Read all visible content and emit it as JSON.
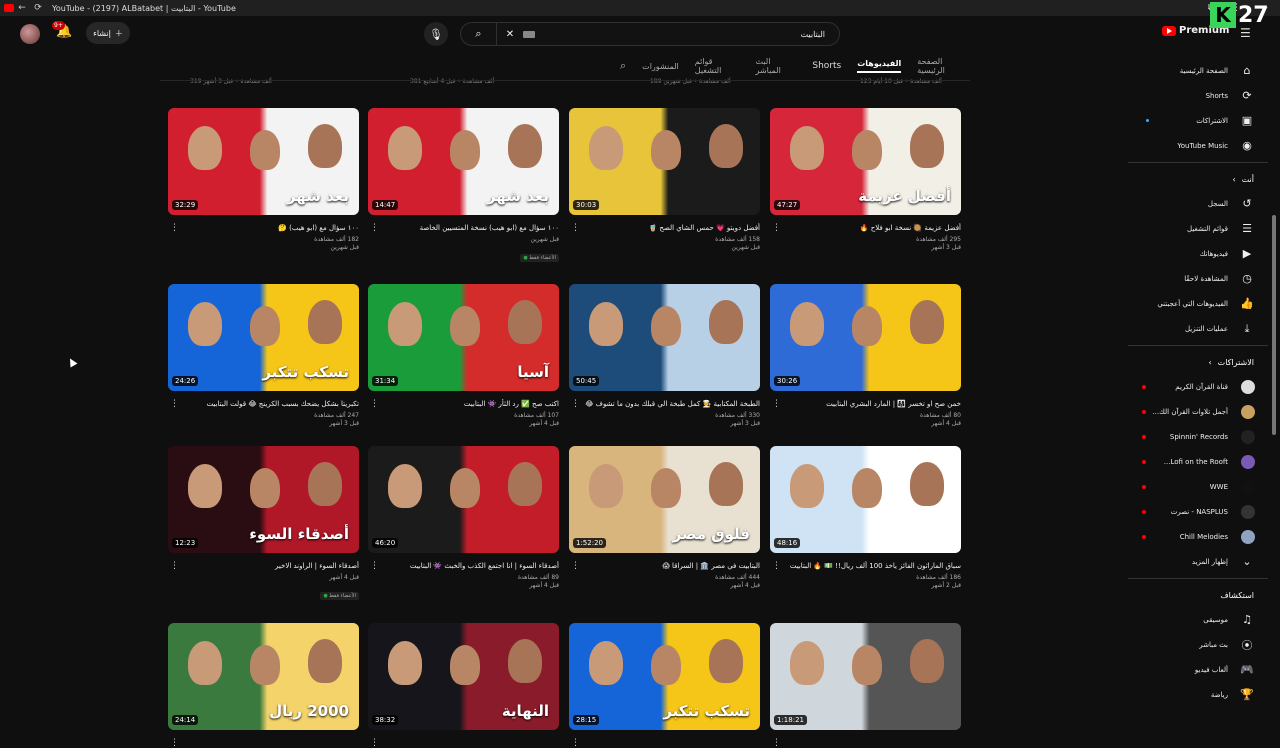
{
  "window": {
    "title": "YouTube - (2197) ALBatabet | البتابيت - YouTube"
  },
  "header": {
    "create_label": "إنشاء",
    "notif_count": "9+",
    "search_value": "البتابيت",
    "logo_text": "Premium",
    "overlay_number": "27"
  },
  "tabs": [
    "الصفحة الرئيسية",
    "الفيديوهات",
    "Shorts",
    "البث المباشر",
    "قوائم التشغيل",
    "المنشورات"
  ],
  "prev_row_meta": [
    "319 ألف مشاهدة • قبل 3 أشهر",
    "381 ألف مشاهدة • قبل 4 أسابيع",
    "189 ألف مشاهدة • قبل شهرين",
    "123 ألف مشاهدة • قبل 10 أيام"
  ],
  "videos": [
    {
      "title": "أفضل عزيمة 🥘 نسخة ابو فلاح 🔥",
      "views": "295 ألف مشاهدة",
      "age": "قبل 3 أشهر",
      "duration": "47:27",
      "overlay": "أفضل عزيمة",
      "members_only": ""
    },
    {
      "title": "أفضل دويتو 💗 حمس الشاي الصح 🧋",
      "views": "158 ألف مشاهدة",
      "age": "قبل شهرين",
      "duration": "30:03",
      "overlay": "",
      "members_only": ""
    },
    {
      "title": "١٠٠ سؤال مع (ابو هيب) نسخة المتسيين الخاصة",
      "views": "قبل شهرين",
      "age": "",
      "duration": "14:47",
      "overlay": "بعد شهر",
      "members_only": "الأعضاء فقط"
    },
    {
      "title": "١٠٠ سؤال مع (ابو هيب) 🤔",
      "views": "182 ألف مشاهدة",
      "age": "قبل شهرين",
      "duration": "32:29",
      "overlay": "بعد شهر",
      "members_only": ""
    },
    {
      "title": "خمن صح او تخسر 👨‍👩‍👧 | المارد البشري البتابيت",
      "views": "80 ألف مشاهدة",
      "age": "قبل 4 أشهر",
      "duration": "30:26",
      "overlay": "",
      "members_only": ""
    },
    {
      "title": "الطبخة المكتابية 🧑‍🍳 كمل طبخة الي قبلك بدون ما تشوف 😂",
      "views": "330 ألف مشاهدة",
      "age": "قبل 3 أشهر",
      "duration": "50:45",
      "overlay": "",
      "members_only": ""
    },
    {
      "title": "اكتب صح ✅ رد الثأر 👾 البتابيت",
      "views": "107 ألف مشاهدة",
      "age": "قبل 4 أشهر",
      "duration": "31:34",
      "overlay": "آسيا",
      "members_only": ""
    },
    {
      "title": "تكبريتا بشكل يضحك بسبب الكرينج 😂 قولت البتابيت",
      "views": "247 ألف مشاهدة",
      "age": "قبل 3 أشهر",
      "duration": "24:26",
      "overlay": "تسكب تتكبر",
      "members_only": ""
    },
    {
      "title": "سباق الماراثون الفائز ياخذ 100 ألف ريال!! 💵 🔥 البتابيت",
      "views": "186 ألف مشاهدة",
      "age": "قبل 2 أشهر",
      "duration": "48:16",
      "overlay": "",
      "members_only": ""
    },
    {
      "title": "البتابيت في مصر 🏛️ | السراقا 😱",
      "views": "444 ألف مشاهدة",
      "age": "قبل 4 أشهر",
      "duration": "1:52:20",
      "overlay": "فلوق مصر",
      "members_only": ""
    },
    {
      "title": "أصدقاء السوء | انا اجتمع الكذب والخبث 👾 البتابيت",
      "views": "89 ألف مشاهدة",
      "age": "قبل 4 أشهر",
      "duration": "46:20",
      "overlay": "",
      "members_only": ""
    },
    {
      "title": "أصدقاء السوء | الراوند الاخير",
      "views": "قبل 4 أشهر",
      "age": "",
      "duration": "12:23",
      "overlay": "أصدقاء السوء",
      "members_only": "الأعضاء فقط"
    },
    {
      "title": "",
      "views": "",
      "age": "",
      "duration": "1:18:21",
      "overlay": "",
      "members_only": ""
    },
    {
      "title": "",
      "views": "",
      "age": "",
      "duration": "28:15",
      "overlay": "تسكب تتكبر",
      "members_only": ""
    },
    {
      "title": "",
      "views": "",
      "age": "",
      "duration": "38:32",
      "overlay": "النهاية",
      "members_only": ""
    },
    {
      "title": "",
      "views": "",
      "age": "",
      "duration": "24:14",
      "overlay": "2000 ريال",
      "members_only": ""
    }
  ],
  "sidebar": {
    "main": [
      {
        "label": "الصفحة الرئيسية",
        "icon": "home-icon"
      },
      {
        "label": "Shorts",
        "icon": "shorts-icon"
      },
      {
        "label": "الاشتراكات",
        "icon": "subscriptions-icon"
      },
      {
        "label": "YouTube Music",
        "icon": "music-icon"
      }
    ],
    "you_heading": "أنت",
    "you": [
      {
        "label": "السجل",
        "icon": "history-icon"
      },
      {
        "label": "قوائم التشغيل",
        "icon": "playlists-icon"
      },
      {
        "label": "فيديوهاتك",
        "icon": "your-videos-icon"
      },
      {
        "label": "المشاهدة لاحقًا",
        "icon": "watch-later-icon"
      },
      {
        "label": "الفيديوهات التي أعجبتني",
        "icon": "liked-icon"
      },
      {
        "label": "عمليات التنزيل",
        "icon": "download-icon"
      }
    ],
    "subs_heading": "الاشتراكات",
    "subs": [
      {
        "label": "قناة القرآن الكريم",
        "color": "#dddddd"
      },
      {
        "label": "أجمل تلاوات القرآن الك...",
        "color": "#c8a060"
      },
      {
        "label": "Spinnin' Records",
        "color": "#222222"
      },
      {
        "label": "Lofi on the Rooft...",
        "color": "#7a5ab5"
      },
      {
        "label": "WWE",
        "color": "#111111"
      },
      {
        "label": "NASPLUS - نصرت",
        "color": "#333333"
      },
      {
        "label": "Chill Melodies",
        "color": "#8fa3c0"
      }
    ],
    "show_more": "إظهار المزيد",
    "explore_heading": "استكشاف",
    "explore": [
      {
        "label": "موسيقى",
        "icon": "music-note-icon"
      },
      {
        "label": "بث مباشر",
        "icon": "live-icon"
      },
      {
        "label": "ألعاب فيديو",
        "icon": "gaming-icon"
      },
      {
        "label": "رياضة",
        "icon": "trophy-icon"
      }
    ]
  }
}
